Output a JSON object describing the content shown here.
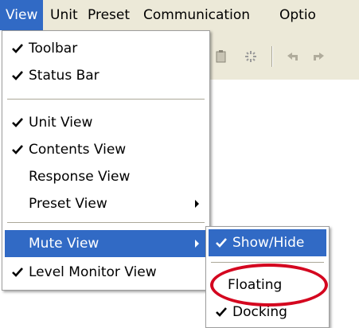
{
  "menubar": {
    "items": [
      "View",
      "Unit",
      "Preset",
      "Communication",
      "Optio"
    ]
  },
  "toolbar": {
    "icons": [
      "clipboard-icon",
      "settings-burst-icon",
      "undo-icon",
      "redo-icon"
    ]
  },
  "view_menu": {
    "items": [
      {
        "label": "Toolbar",
        "checked": true
      },
      {
        "label": "Status Bar",
        "checked": true
      },
      {
        "label": "Unit View",
        "checked": true
      },
      {
        "label": "Contents View",
        "checked": true
      },
      {
        "label": "Response View",
        "checked": false
      },
      {
        "label": "Preset View",
        "checked": false,
        "submenu": true
      },
      {
        "label": "Mute View",
        "checked": false,
        "submenu": true,
        "highlighted": true
      },
      {
        "label": "Level Monitor View",
        "checked": true
      }
    ]
  },
  "mute_submenu": {
    "items": [
      {
        "label": "Show/Hide",
        "checked": true,
        "highlighted": true
      },
      {
        "label": "Floating",
        "checked": false,
        "annotated": true
      },
      {
        "label": "Docking",
        "checked": true
      }
    ]
  },
  "colors": {
    "highlight": "#316ac5",
    "menubar_bg": "#ece9d8",
    "annotation_circle": "#d4061f"
  }
}
